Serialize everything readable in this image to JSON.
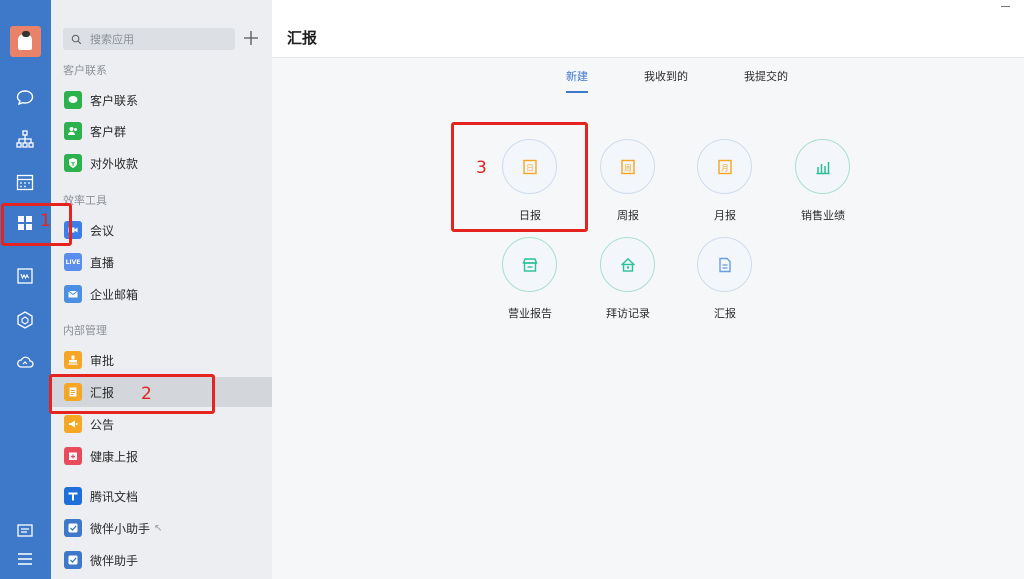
{
  "sidebar": {
    "search_placeholder": "搜索应用",
    "groups": [
      {
        "title": "客户联系"
      },
      {
        "title": "效率工具"
      },
      {
        "title": "内部管理"
      }
    ],
    "items": [
      {
        "label": "客户联系",
        "icon": "chat-bubble-icon",
        "color": "#2bb24c"
      },
      {
        "label": "客户群",
        "icon": "group-icon",
        "color": "#2bb24c"
      },
      {
        "label": "对外收款",
        "icon": "shield-payment-icon",
        "color": "#2bb24c"
      },
      {
        "label": "会议",
        "icon": "video-camera-icon",
        "color": "#3c7ee8"
      },
      {
        "label": "直播",
        "icon": "live-icon",
        "color": "#5b8def",
        "badge": "LIVE"
      },
      {
        "label": "企业邮箱",
        "icon": "mail-icon",
        "color": "#4a90e2"
      },
      {
        "label": "审批",
        "icon": "stamp-icon",
        "color": "#f5a623"
      },
      {
        "label": "汇报",
        "icon": "report-icon",
        "color": "#f5a623"
      },
      {
        "label": "公告",
        "icon": "megaphone-icon",
        "color": "#f5a623"
      },
      {
        "label": "健康上报",
        "icon": "health-icon",
        "color": "#e94b5b"
      },
      {
        "label": "腾讯文档",
        "icon": "tencent-docs-icon",
        "color": "#1e6fd9"
      },
      {
        "label": "微伴小助手",
        "icon": "checkbox-icon",
        "color": "#3d78c9"
      },
      {
        "label": "微伴助手",
        "icon": "checkbox-icon",
        "color": "#3d78c9"
      }
    ]
  },
  "main": {
    "title": "汇报",
    "tabs": [
      {
        "label": "新建",
        "active": true
      },
      {
        "label": "我收到的",
        "active": false
      },
      {
        "label": "我提交的",
        "active": false
      }
    ],
    "tiles": [
      {
        "label": "日报",
        "icon": "daily-report-icon",
        "color": "#f5a623"
      },
      {
        "label": "周报",
        "icon": "weekly-report-icon",
        "color": "#f5a623"
      },
      {
        "label": "月报",
        "icon": "monthly-report-icon",
        "color": "#f5a623"
      },
      {
        "label": "销售业绩",
        "icon": "bar-chart-icon",
        "color": "#2bbf9a"
      },
      {
        "label": "营业报告",
        "icon": "store-icon",
        "color": "#2bbf9a"
      },
      {
        "label": "拜访记录",
        "icon": "house-icon",
        "color": "#2bbf9a"
      },
      {
        "label": "汇报",
        "icon": "document-icon",
        "color": "#6b9de0"
      }
    ]
  },
  "annotations": {
    "one": "1",
    "two": "2",
    "three": "3",
    "color": "#e5231f"
  },
  "theme": {
    "rail_color": "#3d78c9",
    "accent": "#3d78c9"
  }
}
